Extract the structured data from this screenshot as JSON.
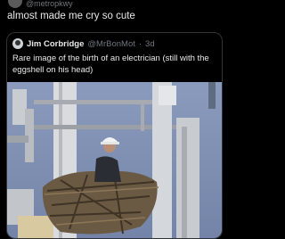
{
  "top_handle": "@metropkwy",
  "post": {
    "text": "almost made me cry so cute"
  },
  "quote": {
    "author_name": "Jim Corbridge",
    "author_handle": "@MrBonMot",
    "separator": "·",
    "time": "3d",
    "text": "Rare image of the birth of an electrician (still with the eggshell on his head)"
  },
  "colors": {
    "background": "#000000",
    "text": "#e7e9ea",
    "muted": "#71767b",
    "border": "#2f3336",
    "sky": "#7d8fb3"
  }
}
